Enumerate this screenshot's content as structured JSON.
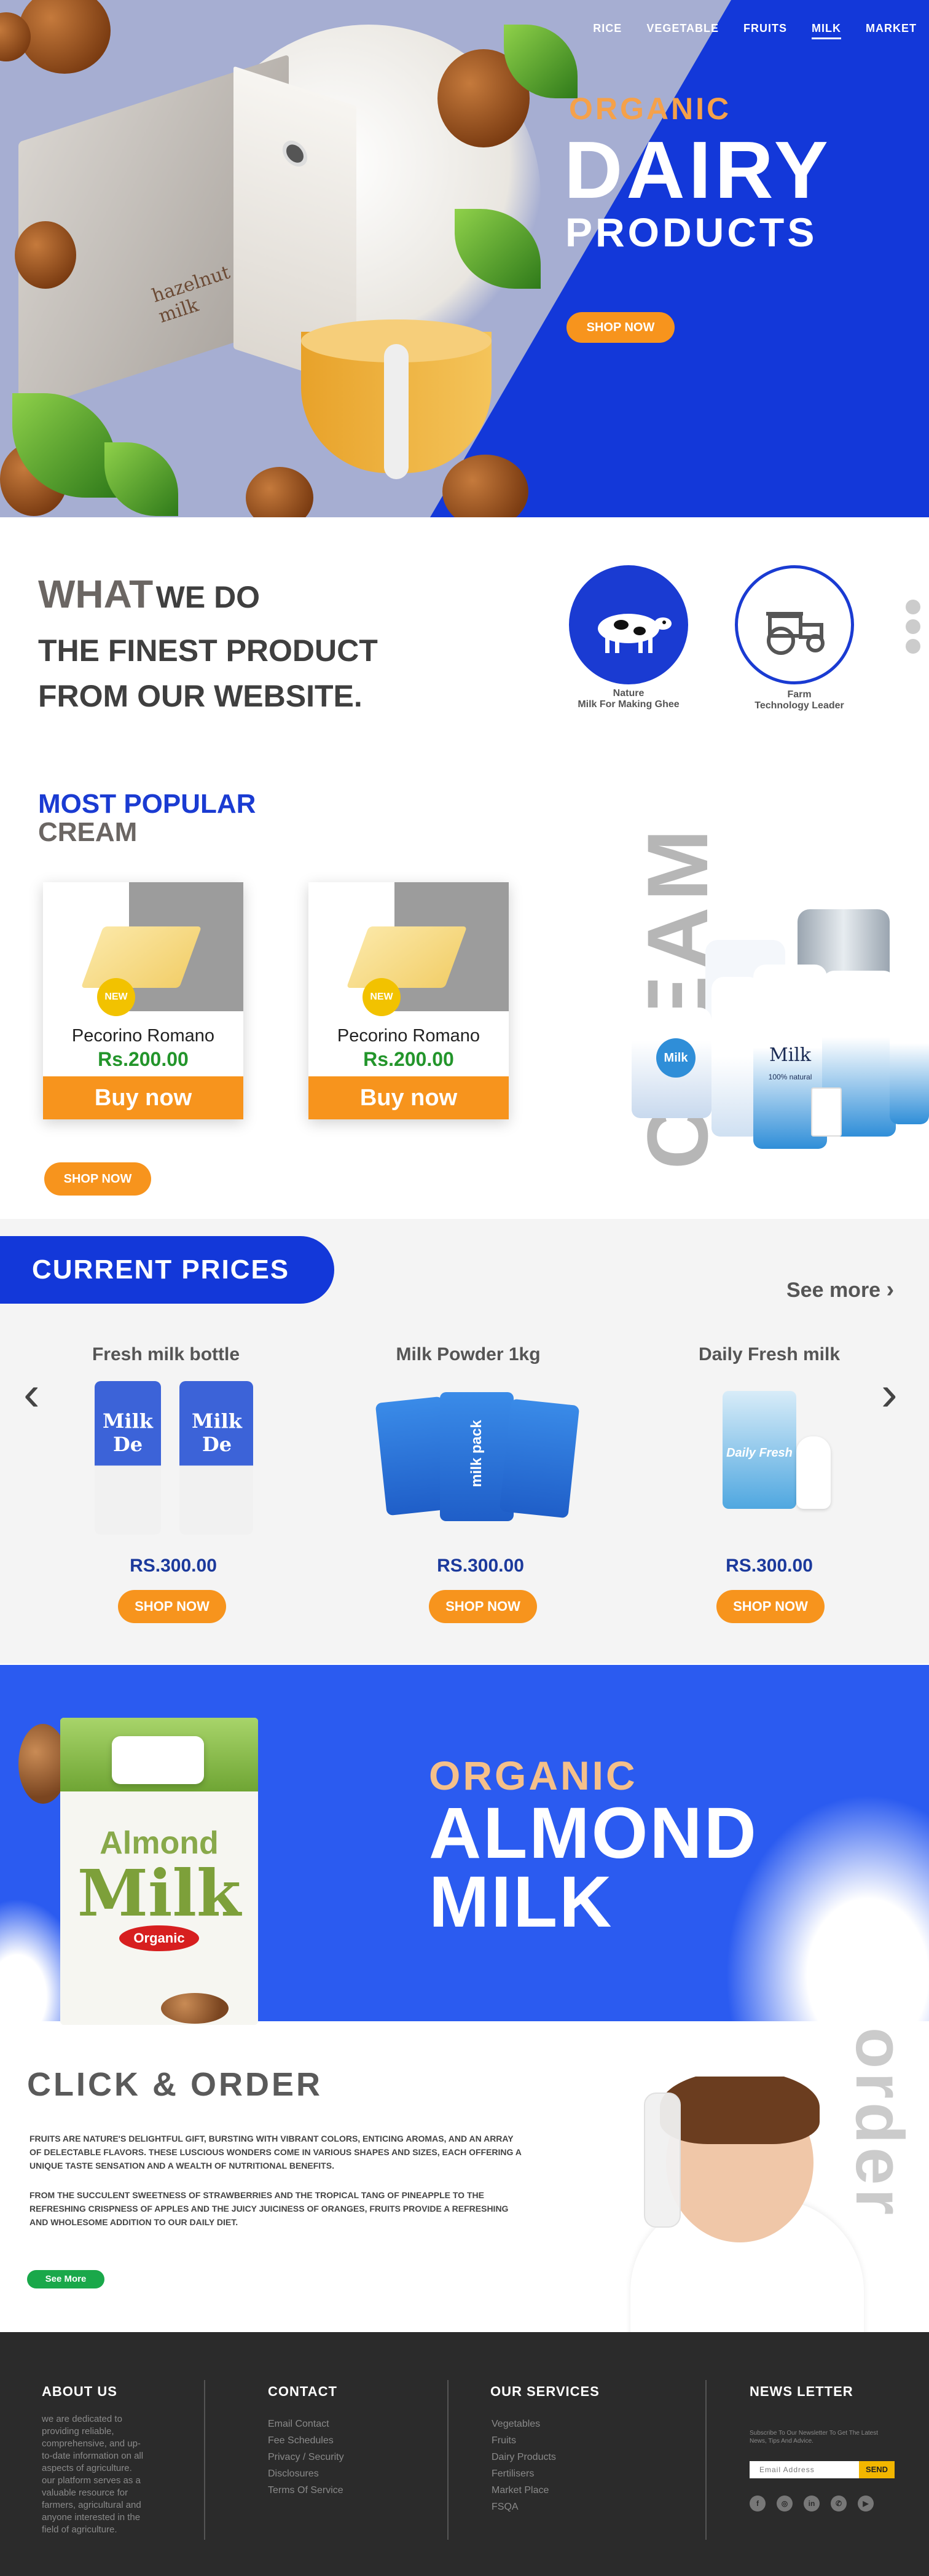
{
  "nav": {
    "items": [
      "RICE",
      "VEGETABLE",
      "FRUITS",
      "MILK",
      "MARKET"
    ],
    "active": "MILK"
  },
  "hero": {
    "subtitle": "ORGANIC",
    "title": "DAIRY",
    "title2": "PRODUCTS",
    "cta": "SHOP NOW",
    "carton_text": "hazelnut milk"
  },
  "what": {
    "word1": "WHAT",
    "word2": "WE DO",
    "line2": "THE FINEST PRODUCT",
    "line3": "FROM OUR WEBSITE."
  },
  "features": [
    {
      "label1": "Nature",
      "label2": "Milk For Making Ghee",
      "icon": "cow-icon"
    },
    {
      "label1": "Farm",
      "label2": "Technology Leader",
      "icon": "tractor-icon"
    }
  ],
  "popular": {
    "title1": "MOST POPULAR",
    "title2": "CREAM",
    "cta": "SHOP NOW",
    "vertical": "CREAM",
    "cards": [
      {
        "badge": "NEW",
        "name": "Pecorino Romano",
        "price": "Rs.200.00",
        "button": "Buy now"
      },
      {
        "badge": "NEW",
        "name": "Pecorino Romano",
        "price": "Rs.200.00",
        "button": "Buy now"
      }
    ],
    "bottle_label": "Milk",
    "bottle_sub": "100% natural"
  },
  "prices": {
    "title": "CURRENT PRICES",
    "see_more": "See more",
    "products": [
      {
        "name": "Fresh milk bottle",
        "price": "RS.300.00",
        "button": "SHOP NOW",
        "pack_text": "Milk De"
      },
      {
        "name": "Milk Powder 1kg",
        "price": "RS.300.00",
        "button": "SHOP NOW",
        "pack_text": "milk pack"
      },
      {
        "name": "Daily Fresh milk",
        "price": "RS.300.00",
        "button": "SHOP NOW",
        "pack_text": "Daily Fresh"
      }
    ]
  },
  "almond": {
    "subtitle": "ORGANIC",
    "line1": "ALMOND",
    "line2": "MILK",
    "box_word1": "Almond",
    "box_word2": "Milk",
    "box_badge": "Organic"
  },
  "order": {
    "title": "CLICK & ORDER",
    "para1": "Fruits are nature's delightful gift, bursting with vibrant colors, enticing aromas, and an array of delectable flavors. These luscious wonders come in various shapes and sizes, each offering a unique taste sensation and a wealth of nutritional benefits.",
    "para2": "From the succulent sweetness of strawberries and the tropical tang of pineapple to the refreshing crispness of apples and the juicy juiciness of oranges, fruits provide a refreshing and wholesome addition to our daily diet.",
    "button": "See More",
    "vertical": "order"
  },
  "footer": {
    "about_title": "ABOUT US",
    "about_text": "we are dedicated to providing reliable, comprehensive, and up-to-date information on all aspects of agriculture. our platform serves as a valuable resource for farmers, agricultural and anyone interested in the field of agriculture.",
    "contact_title": "CONTACT",
    "contact_links": [
      "Email Contact",
      "Fee Schedules",
      "Privacy / Security",
      "Disclosures",
      "Terms Of Service"
    ],
    "services_title": "OUR SERVICES",
    "services_links": [
      "Vegetables",
      "Fruits",
      "Dairy Products",
      "Fertilisers",
      "Market Place",
      "FSQA"
    ],
    "news_title": "NEWS LETTER",
    "news_text": "Subscribe To Our Newsletter To Get The Latest News, Tips And Advice.",
    "news_placeholder": "Email Address",
    "news_button": "SEND",
    "social": [
      "facebook-icon",
      "instagram-icon",
      "linkedin-icon",
      "whatsapp-icon",
      "youtube-icon"
    ]
  },
  "colors": {
    "primary_blue": "#1338d9",
    "orange": "#f7941d",
    "green": "#23952b",
    "footer": "#2b2b2b"
  }
}
